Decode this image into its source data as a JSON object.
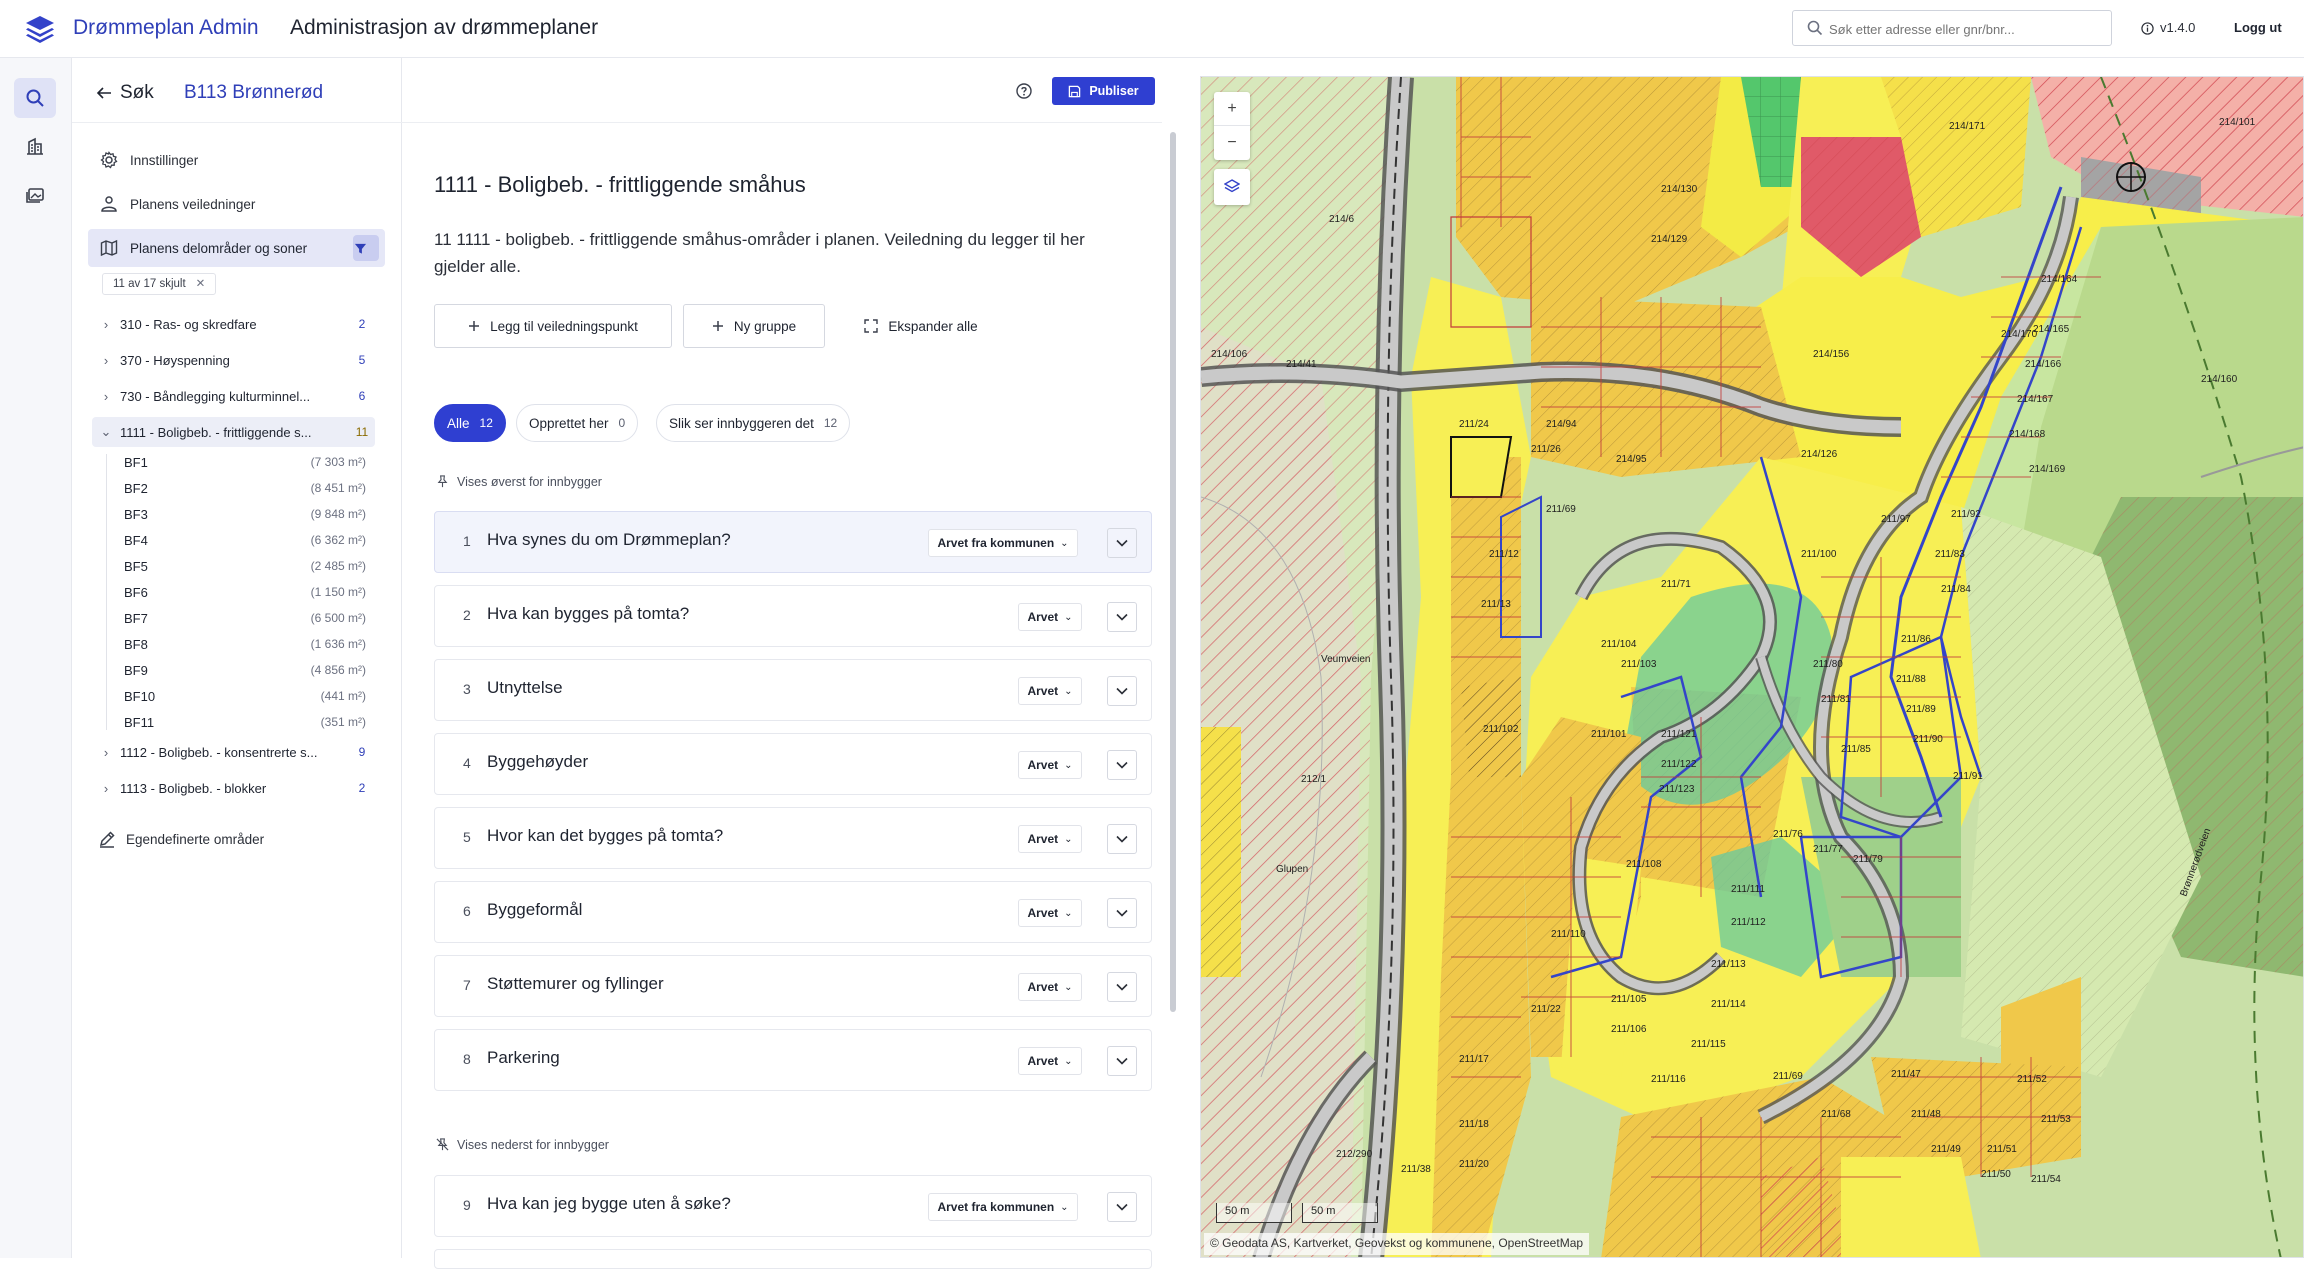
{
  "app": {
    "name": "Drømmeplan Admin",
    "title": "Administrasjon av drømmeplaner"
  },
  "search": {
    "placeholder": "Søk etter adresse eller gnr/bnr..."
  },
  "version": "v1.4.0",
  "logout": "Logg ut",
  "colors": {
    "accent": "#2f3fd1",
    "brand": "#2f3fb8",
    "active_bg": "#e5e7f7"
  },
  "rail": {
    "icons": [
      "search-icon",
      "building-icon",
      "gallery-icon"
    ]
  },
  "header": {
    "back_label": "Søk",
    "plan_name": "B113 Brønnerød",
    "publish_label": "Publiser"
  },
  "sidebar": {
    "nav": [
      {
        "label": "Innstillinger",
        "icon": "gear-icon"
      },
      {
        "label": "Planens veiledninger",
        "icon": "people-icon"
      },
      {
        "label": "Planens delområder og soner",
        "icon": "map-icon"
      }
    ],
    "hidden_chip": "11 av 17 skjult",
    "tree": [
      {
        "label": "310 - Ras- og skredfare",
        "count": "2"
      },
      {
        "label": "370 - Høyspenning",
        "count": "5"
      },
      {
        "label": "730 - Båndlegging kulturminnel...",
        "count": "6"
      },
      {
        "label": "1111 - Boligbeb. - frittliggende s...",
        "count": "11"
      },
      {
        "label": "1112 - Boligbeb. - konsentrerte s...",
        "count": "9"
      },
      {
        "label": "1113 - Boligbeb. - blokker",
        "count": "2"
      }
    ],
    "subareas": [
      {
        "name": "BF1",
        "area": "(7 303 m²)"
      },
      {
        "name": "BF2",
        "area": "(8 451 m²)"
      },
      {
        "name": "BF3",
        "area": "(9 848 m²)"
      },
      {
        "name": "BF4",
        "area": "(6 362 m²)"
      },
      {
        "name": "BF5",
        "area": "(2 485 m²)"
      },
      {
        "name": "BF6",
        "area": "(1 150 m²)"
      },
      {
        "name": "BF7",
        "area": "(6 500 m²)"
      },
      {
        "name": "BF8",
        "area": "(1 636 m²)"
      },
      {
        "name": "BF9",
        "area": "(4 856 m²)"
      },
      {
        "name": "BF10",
        "area": "(441 m²)"
      },
      {
        "name": "BF11",
        "area": "(351 m²)"
      }
    ],
    "custom_areas": "Egendefinerte områder"
  },
  "main": {
    "title": "1111 - Boligbeb. - frittliggende småhus",
    "description": "11 1111 - boligbeb. - frittliggende småhus-områder i planen. Veiledning du legger til her gjelder alle.",
    "buttons": {
      "add": "Legg til veiledningspunkt",
      "group": "Ny gruppe",
      "expand": "Ekspander alle"
    },
    "filters": [
      {
        "label": "Alle",
        "count": "12"
      },
      {
        "label": "Opprettet her",
        "count": "0"
      },
      {
        "label": "Slik ser innbyggeren det",
        "count": "12"
      }
    ],
    "section_top": "Vises øverst for innbygger",
    "section_bottom": "Vises nederst for innbygger",
    "items": [
      {
        "n": "1",
        "title": "Hva synes du om Drømmeplan?",
        "tag": "Arvet fra kommunen"
      },
      {
        "n": "2",
        "title": "Hva kan bygges på tomta?",
        "tag": "Arvet"
      },
      {
        "n": "3",
        "title": "Utnyttelse",
        "tag": "Arvet"
      },
      {
        "n": "4",
        "title": "Byggehøyder",
        "tag": "Arvet"
      },
      {
        "n": "5",
        "title": "Hvor kan det bygges på tomta?",
        "tag": "Arvet"
      },
      {
        "n": "6",
        "title": "Byggeformål",
        "tag": "Arvet"
      },
      {
        "n": "7",
        "title": "Støttemurer og fyllinger",
        "tag": "Arvet"
      },
      {
        "n": "8",
        "title": "Parkering",
        "tag": "Arvet"
      },
      {
        "n": "9",
        "title": "Hva kan jeg bygge uten å søke?",
        "tag": "Arvet fra kommunen"
      }
    ]
  },
  "map": {
    "zoom_in": "+",
    "zoom_out": "−",
    "scale": [
      "50 m",
      "50 m"
    ],
    "attribution": "© Geodata AS, Kartverket, Geovekst og kommunene, OpenStreetMap",
    "labels": [
      "214/6",
      "214/41",
      "214/106",
      "211/24",
      "211/26",
      "214/94",
      "214/95",
      "211/69",
      "211/12",
      "211/13",
      "211/71",
      "211/100",
      "211/97",
      "211/92",
      "211/83",
      "211/84",
      "211/86",
      "211/88",
      "211/89",
      "211/90",
      "211/91",
      "211/80",
      "211/81",
      "211/85",
      "211/79",
      "211/77",
      "211/76",
      "211/111",
      "211/112",
      "211/113",
      "211/114",
      "211/115",
      "211/116",
      "211/108",
      "211/110",
      "211/105",
      "211/106",
      "211/121",
      "211/122",
      "211/123",
      "211/101",
      "211/102",
      "211/103",
      "211/104",
      "214/170",
      "214/160",
      "214/164",
      "214/165",
      "214/166",
      "214/167",
      "214/168",
      "214/169",
      "214/156",
      "214/126",
      "214/129",
      "214/130",
      "214/171",
      "214/101",
      "211/68",
      "211/69",
      "211/47",
      "211/48",
      "211/49",
      "211/50",
      "211/51",
      "211/52",
      "211/53",
      "211/54",
      "211/17",
      "211/18",
      "211/20",
      "211/22",
      "212/1",
      "212/290",
      "211/38",
      "Veumveien",
      "Glupen",
      "Brønnerødveien"
    ]
  }
}
